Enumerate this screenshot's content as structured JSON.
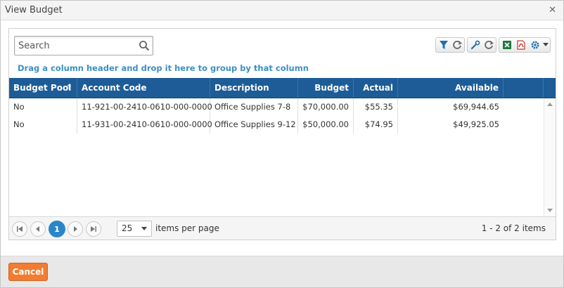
{
  "dialog": {
    "title": "View Budget"
  },
  "toolbar": {
    "search_placeholder": "Search",
    "group_hint": "Drag a column header and drop it here to group by that column"
  },
  "grid": {
    "columns": [
      "Budget Pool",
      "Account Code",
      "Description",
      "Budget",
      "Actual",
      "Available"
    ],
    "sort_indicator": "↑",
    "rows": [
      [
        "No",
        "11-921-00-2410-0610-000-0000",
        "Office Supplies 7-8",
        "$70,000.00",
        "$55.35",
        "$69,944.65"
      ],
      [
        "No",
        "11-931-00-2410-0610-000-0000",
        "Office Supplies 9-12",
        "$50,000.00",
        "$74.95",
        "$49,925.05"
      ]
    ]
  },
  "pager": {
    "current_page": "1",
    "page_size": "25",
    "items_per_page_label": "items per page",
    "info": "1 - 2 of 2 items"
  },
  "footer": {
    "cancel_label": "Cancel"
  },
  "colors": {
    "header_bg": "#1d5c96",
    "accent_blue": "#2b86c9",
    "link_blue": "#3a8fc4",
    "cancel_orange": "#f07d32"
  }
}
